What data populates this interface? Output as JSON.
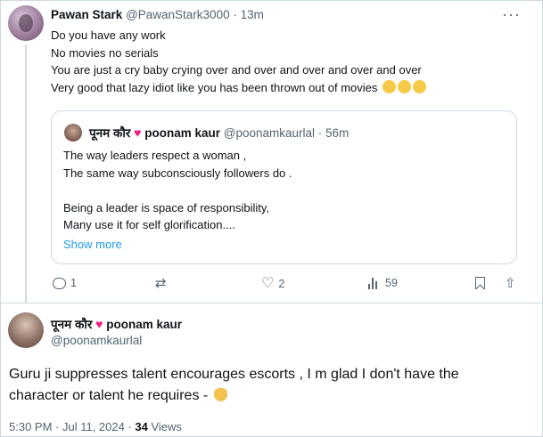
{
  "top_tweet": {
    "name": "Pawan Stark",
    "handle": "@PawanStark3000",
    "dot": "·",
    "time": "13m",
    "lines": [
      "Do you have any work",
      "No movies no serials",
      "You are just a cry baby crying over and over and over and over and over",
      "Very good that lazy idiot like you has been thrown out of movies"
    ],
    "emoji": "clapping-hands-icon",
    "quote": {
      "deva_name": "पूनम कौर",
      "name": "poonam kaur",
      "handle": "@poonamkaurlal",
      "dot": "·",
      "time": "56m",
      "lines": [
        "The way leaders respect a woman ,",
        "The same way subconsciously followers do .",
        "",
        "Being a leader is space of responsibility,",
        "Many use it for self glorification...."
      ],
      "show_more": "Show more"
    },
    "actions": {
      "reply_count": "1",
      "retweet_count": "",
      "like_count": "2",
      "views_count": "59"
    }
  },
  "bottom_tweet": {
    "deva_name": "पूनम कौर",
    "name": "poonam kaur",
    "handle": "@poonamkaurlal",
    "lines": [
      "Guru ji suppresses talent encourages escorts , I m glad I don't have the",
      "character or talent he requires - "
    ],
    "meta_time": "5:30 PM · Jul 11, 2024 · ",
    "meta_views": "34",
    "meta_views_label": " Views"
  },
  "colors": {
    "text": "#0f1419",
    "secondary": "#536471",
    "link": "#1d9bf0",
    "heart": "#f91880",
    "border": "#cfd9de"
  }
}
